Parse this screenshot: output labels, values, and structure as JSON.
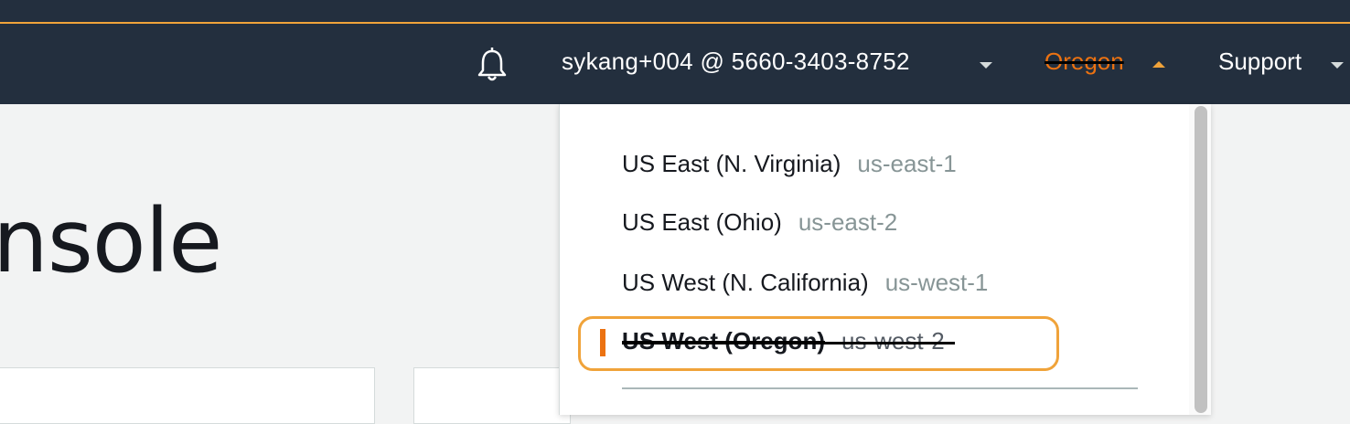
{
  "header": {
    "account_label": "sykang+004 @ 5660-3403-8752",
    "region_label": "Oregon",
    "support_label": "Support",
    "icons": {
      "notifications": "bell-icon",
      "account_menu": "chevron-down-icon",
      "region_menu": "chevron-up-icon",
      "support_menu": "chevron-down-icon"
    }
  },
  "main": {
    "title_fragment": "nsole"
  },
  "region_dropdown": {
    "items": [
      {
        "name": "US East (N. Virginia)",
        "code": "us-east-1"
      },
      {
        "name": "US East (Ohio)",
        "code": "us-east-2"
      },
      {
        "name": "US West (N. California)",
        "code": "us-west-1"
      },
      {
        "name": "US West (Oregon)",
        "code": "us-west-2",
        "selected": true
      }
    ]
  },
  "colors": {
    "nav_bg": "#232f3e",
    "accent_orange": "#f0a33a",
    "region_text": "#ec7211",
    "highlight_border": "#f0a33a"
  }
}
